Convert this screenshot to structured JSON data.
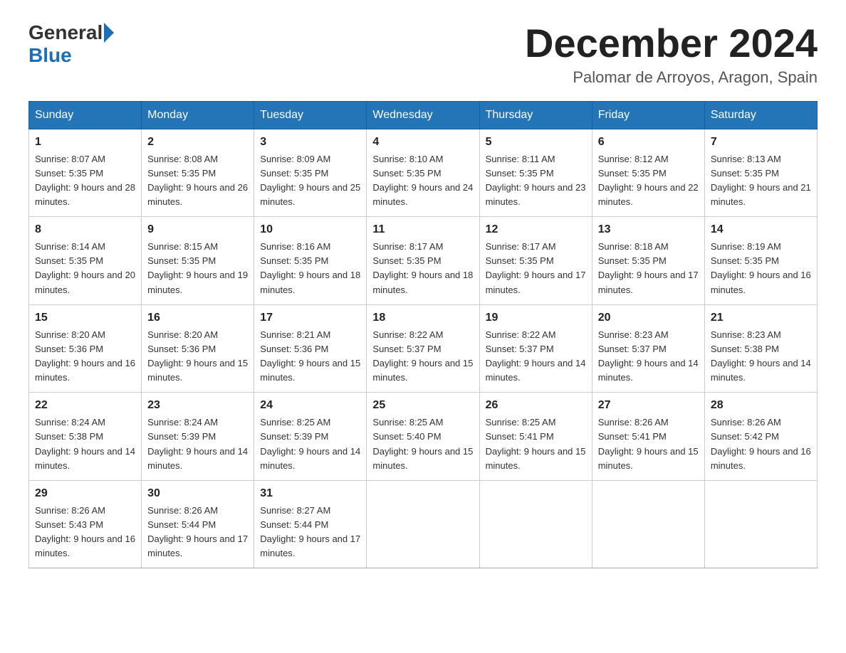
{
  "header": {
    "logo_general": "General",
    "logo_blue": "Blue",
    "month_title": "December 2024",
    "location": "Palomar de Arroyos, Aragon, Spain"
  },
  "days_of_week": [
    "Sunday",
    "Monday",
    "Tuesday",
    "Wednesday",
    "Thursday",
    "Friday",
    "Saturday"
  ],
  "weeks": [
    [
      {
        "day": "1",
        "sunrise": "8:07 AM",
        "sunset": "5:35 PM",
        "daylight": "9 hours and 28 minutes."
      },
      {
        "day": "2",
        "sunrise": "8:08 AM",
        "sunset": "5:35 PM",
        "daylight": "9 hours and 26 minutes."
      },
      {
        "day": "3",
        "sunrise": "8:09 AM",
        "sunset": "5:35 PM",
        "daylight": "9 hours and 25 minutes."
      },
      {
        "day": "4",
        "sunrise": "8:10 AM",
        "sunset": "5:35 PM",
        "daylight": "9 hours and 24 minutes."
      },
      {
        "day": "5",
        "sunrise": "8:11 AM",
        "sunset": "5:35 PM",
        "daylight": "9 hours and 23 minutes."
      },
      {
        "day": "6",
        "sunrise": "8:12 AM",
        "sunset": "5:35 PM",
        "daylight": "9 hours and 22 minutes."
      },
      {
        "day": "7",
        "sunrise": "8:13 AM",
        "sunset": "5:35 PM",
        "daylight": "9 hours and 21 minutes."
      }
    ],
    [
      {
        "day": "8",
        "sunrise": "8:14 AM",
        "sunset": "5:35 PM",
        "daylight": "9 hours and 20 minutes."
      },
      {
        "day": "9",
        "sunrise": "8:15 AM",
        "sunset": "5:35 PM",
        "daylight": "9 hours and 19 minutes."
      },
      {
        "day": "10",
        "sunrise": "8:16 AM",
        "sunset": "5:35 PM",
        "daylight": "9 hours and 18 minutes."
      },
      {
        "day": "11",
        "sunrise": "8:17 AM",
        "sunset": "5:35 PM",
        "daylight": "9 hours and 18 minutes."
      },
      {
        "day": "12",
        "sunrise": "8:17 AM",
        "sunset": "5:35 PM",
        "daylight": "9 hours and 17 minutes."
      },
      {
        "day": "13",
        "sunrise": "8:18 AM",
        "sunset": "5:35 PM",
        "daylight": "9 hours and 17 minutes."
      },
      {
        "day": "14",
        "sunrise": "8:19 AM",
        "sunset": "5:35 PM",
        "daylight": "9 hours and 16 minutes."
      }
    ],
    [
      {
        "day": "15",
        "sunrise": "8:20 AM",
        "sunset": "5:36 PM",
        "daylight": "9 hours and 16 minutes."
      },
      {
        "day": "16",
        "sunrise": "8:20 AM",
        "sunset": "5:36 PM",
        "daylight": "9 hours and 15 minutes."
      },
      {
        "day": "17",
        "sunrise": "8:21 AM",
        "sunset": "5:36 PM",
        "daylight": "9 hours and 15 minutes."
      },
      {
        "day": "18",
        "sunrise": "8:22 AM",
        "sunset": "5:37 PM",
        "daylight": "9 hours and 15 minutes."
      },
      {
        "day": "19",
        "sunrise": "8:22 AM",
        "sunset": "5:37 PM",
        "daylight": "9 hours and 14 minutes."
      },
      {
        "day": "20",
        "sunrise": "8:23 AM",
        "sunset": "5:37 PM",
        "daylight": "9 hours and 14 minutes."
      },
      {
        "day": "21",
        "sunrise": "8:23 AM",
        "sunset": "5:38 PM",
        "daylight": "9 hours and 14 minutes."
      }
    ],
    [
      {
        "day": "22",
        "sunrise": "8:24 AM",
        "sunset": "5:38 PM",
        "daylight": "9 hours and 14 minutes."
      },
      {
        "day": "23",
        "sunrise": "8:24 AM",
        "sunset": "5:39 PM",
        "daylight": "9 hours and 14 minutes."
      },
      {
        "day": "24",
        "sunrise": "8:25 AM",
        "sunset": "5:39 PM",
        "daylight": "9 hours and 14 minutes."
      },
      {
        "day": "25",
        "sunrise": "8:25 AM",
        "sunset": "5:40 PM",
        "daylight": "9 hours and 15 minutes."
      },
      {
        "day": "26",
        "sunrise": "8:25 AM",
        "sunset": "5:41 PM",
        "daylight": "9 hours and 15 minutes."
      },
      {
        "day": "27",
        "sunrise": "8:26 AM",
        "sunset": "5:41 PM",
        "daylight": "9 hours and 15 minutes."
      },
      {
        "day": "28",
        "sunrise": "8:26 AM",
        "sunset": "5:42 PM",
        "daylight": "9 hours and 16 minutes."
      }
    ],
    [
      {
        "day": "29",
        "sunrise": "8:26 AM",
        "sunset": "5:43 PM",
        "daylight": "9 hours and 16 minutes."
      },
      {
        "day": "30",
        "sunrise": "8:26 AM",
        "sunset": "5:44 PM",
        "daylight": "9 hours and 17 minutes."
      },
      {
        "day": "31",
        "sunrise": "8:27 AM",
        "sunset": "5:44 PM",
        "daylight": "9 hours and 17 minutes."
      },
      null,
      null,
      null,
      null
    ]
  ]
}
